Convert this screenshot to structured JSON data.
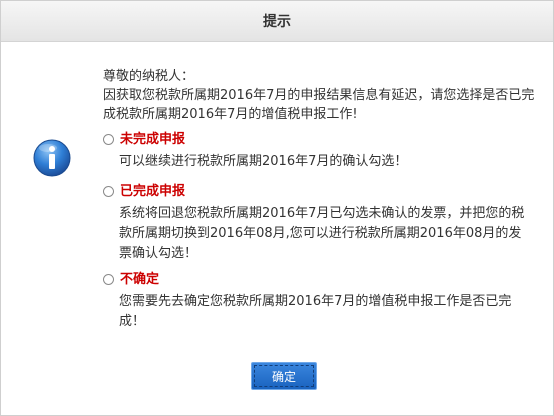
{
  "dialog": {
    "title": "提示",
    "greeting": "尊敬的纳税人：",
    "question": "因获取您税款所属期2016年7月的申报结果信息有延迟，请您选择是否已完成税款所属期2016年7月的增值税申报工作!",
    "icon": "info-icon",
    "options": [
      {
        "label": "未完成申报",
        "description": "可以继续进行税款所属期2016年7月的确认勾选！"
      },
      {
        "label": "已完成申报",
        "description": "系统将回退您税款所属期2016年7月已勾选未确认的发票，并把您的税款所属期切换到2016年08月,您可以进行税款所属期2016年08月的发票确认勾选！"
      },
      {
        "label": "不确定",
        "description": "您需要先去确定您税款所属期2016年7月的增值税申报工作是否已完成！"
      }
    ],
    "confirm_label": "确定"
  },
  "colors": {
    "option_label": "#cc0000",
    "button": "#1f6fcc",
    "icon_blue": "#2b6fc4"
  }
}
